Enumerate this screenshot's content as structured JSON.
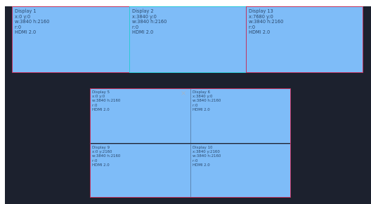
{
  "displays": {
    "d1": {
      "name": "Display 1",
      "pos": "x:0  y:0",
      "size": "w:3840  h:2160",
      "rot": "r:0",
      "port": "HDMI 2.0"
    },
    "d2": {
      "name": "Display 2",
      "pos": "x:3840  y:0",
      "size": "w:3840  h:2160",
      "rot": "r:0",
      "port": "HDMI 2.0"
    },
    "d13": {
      "name": "Display 13",
      "pos": "x:7680  y:0",
      "size": "w:3840  h:2160",
      "rot": "r:0",
      "port": "HDMI 2.0"
    },
    "d5": {
      "name": "Display 5",
      "pos": "x:0  y:0",
      "size": "w:3840  h:2160",
      "rot": "r:0",
      "port": "HDMI 2.0"
    },
    "d6": {
      "name": "Display 6",
      "pos": "x:3840  y:0",
      "size": "w:3840  h:2160",
      "rot": "r:0",
      "port": "HDMI 2.0"
    },
    "d9": {
      "name": "Display 9",
      "pos": "x:0  y:2160",
      "size": "w:3840  h:2160",
      "rot": "r:0",
      "port": "HDMI 2.0"
    },
    "d10": {
      "name": "Display 10",
      "pos": "x:3840  y:2160",
      "size": "w:3840  h:2160",
      "rot": "r:0",
      "port": "HDMI 2.0"
    }
  },
  "close_glyph": "×",
  "colors": {
    "canvas": "#1c212e",
    "display_fill": "#7ebcf8",
    "border_default": "#c0345f",
    "border_selected": "#2fc9d6"
  }
}
